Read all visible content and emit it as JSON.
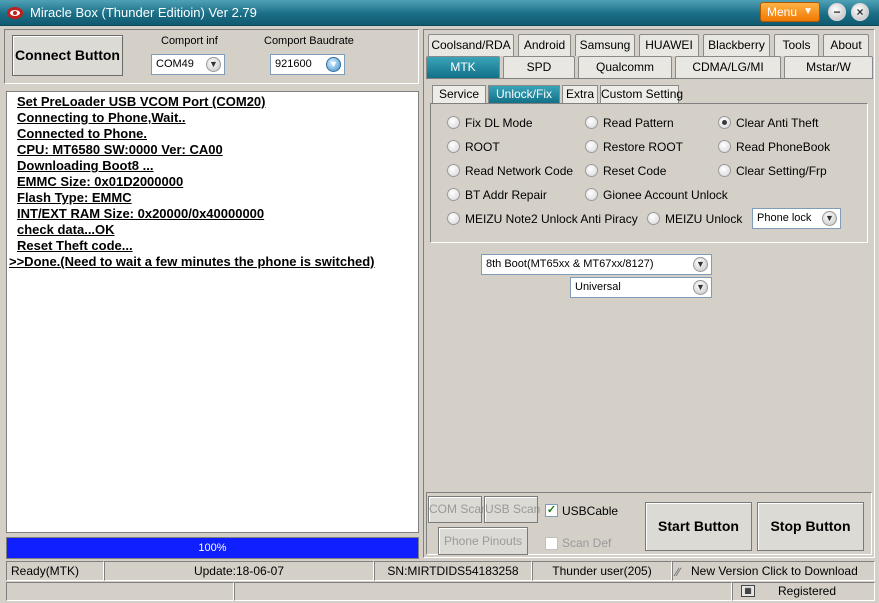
{
  "window": {
    "title": "Miracle Box (Thunder Editioin) Ver 2.79",
    "menu_label": "Menu",
    "minimize_glyph": "−",
    "close_glyph": "×"
  },
  "connect": {
    "button_label": "Connect Button",
    "comport_label": "Comport inf",
    "comport_value": "COM49",
    "baud_label": "Comport Baudrate",
    "baud_value": "921600"
  },
  "log": [
    "Set PreLoader USB VCOM Port (COM20)",
    "Connecting to Phone,Wait..",
    "Connected to Phone.",
    "CPU: MT6580 SW:0000 Ver: CA00",
    "Downloading Boot8 ...",
    "EMMC Size: 0x01D2000000",
    "Flash Type: EMMC",
    "INT/EXT RAM  Size: 0x20000/0x40000000",
    "check data...OK",
    "Reset Theft code...",
    ">>Done.(Need to wait a few minutes the phone is switched)"
  ],
  "progress": {
    "label": "100%",
    "value": 100
  },
  "tabs_row1": [
    "Coolsand/RDA",
    "Android",
    "Samsung",
    "HUAWEI",
    "Blackberry",
    "Tools",
    "About"
  ],
  "tabs_row2": [
    "MTK",
    "SPD",
    "Qualcomm",
    "CDMA/LG/MI",
    "Mstar/W"
  ],
  "subtabs": [
    "Service",
    "Unlock/Fix",
    "Extra",
    "Custom Setting"
  ],
  "options": {
    "fix_dl_mode": "Fix DL Mode",
    "read_pattern": "Read Pattern",
    "clear_anti_theft": "Clear Anti Theft",
    "root": "ROOT",
    "restore_root": "Restore ROOT",
    "read_phonebook": "Read PhoneBook",
    "read_network_code": "Read Network Code",
    "reset_code": "Reset Code",
    "clear_setting_frp": "Clear Setting/Frp",
    "bt_addr_repair": "BT Addr Repair",
    "gionee_account_unlock": "Gionee Account Unlock",
    "meizu_note2": "MEIZU Note2  Unlock Anti Piracy",
    "meizu_unlock": "MEIZU  Unlock",
    "phone_lock_select": "Phone lock"
  },
  "boot_select": "8th Boot(MT65xx & MT67xx/8127)",
  "model_select": "Universal",
  "bottom": {
    "com_scan": "COM Scan",
    "usb_scan": "USB Scan",
    "usb_cable": "USBCable",
    "phone_pinouts": "Phone Pinouts",
    "scan_def": "Scan Def",
    "start": "Start Button",
    "stop": "Stop Button"
  },
  "status": {
    "mode": "Ready(MTK)",
    "update": "Update:18-06-07",
    "sn": "SN:MIRTDIDS54183258",
    "user": "Thunder user(205)",
    "new_version": "New Version Click to Download",
    "registered": "Registered"
  },
  "colors": {
    "accent": "#127187",
    "progress": "#0f1fff",
    "menu": "#f07800"
  }
}
